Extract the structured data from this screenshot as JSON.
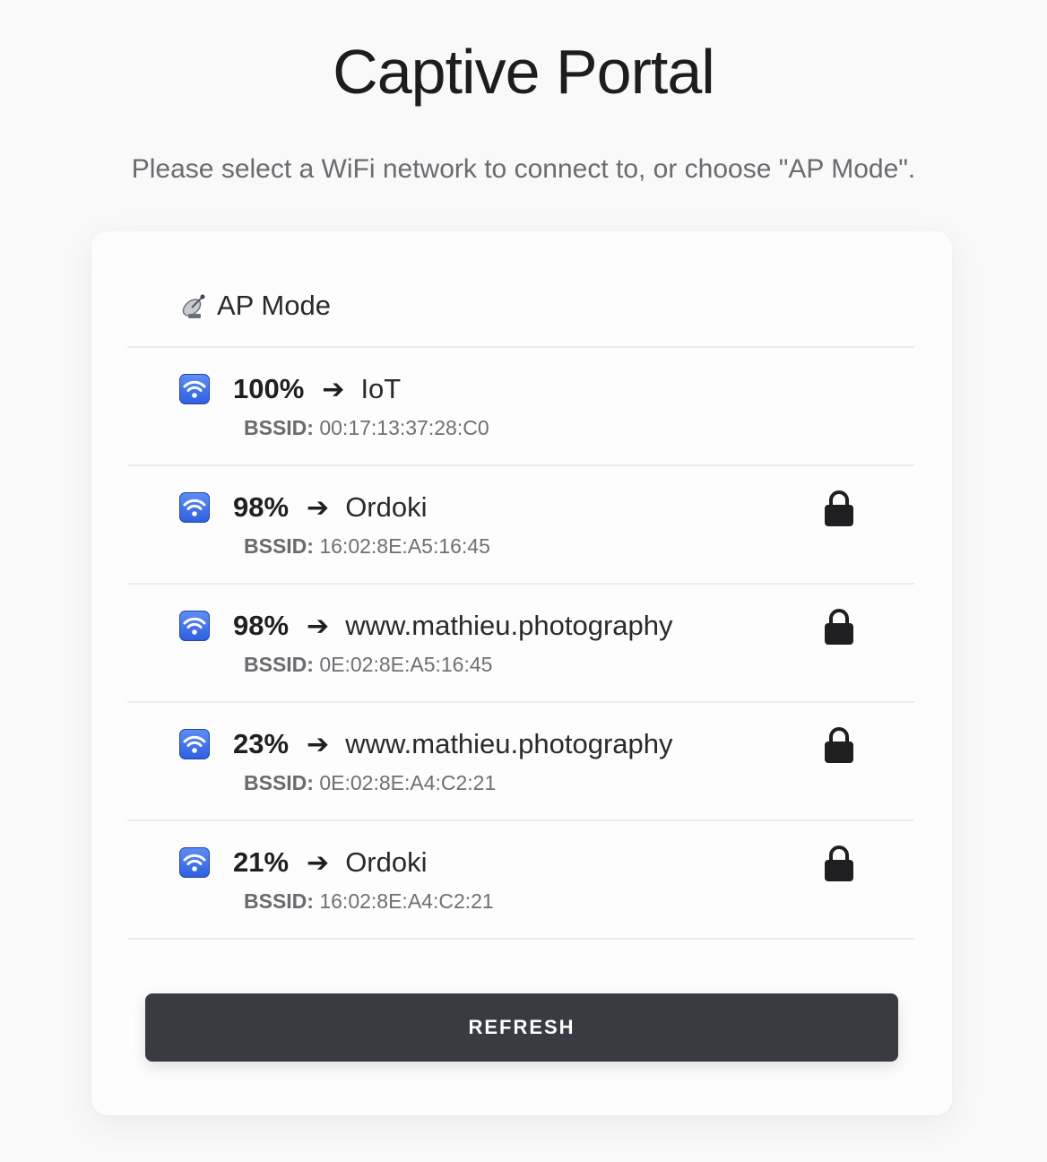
{
  "header": {
    "title": "Captive Portal",
    "subtitle": "Please select a WiFi network to connect to, or choose \"AP Mode\"."
  },
  "ap_mode": {
    "label": "AP Mode",
    "icon": "satellite-dish-icon"
  },
  "networks": [
    {
      "signal": "100%",
      "arrow": "➔",
      "ssid": "IoT",
      "bssid_label": "BSSID:",
      "bssid": "00:17:13:37:28:C0",
      "locked": false
    },
    {
      "signal": "98%",
      "arrow": "➔",
      "ssid": "Ordoki",
      "bssid_label": "BSSID:",
      "bssid": "16:02:8E:A5:16:45",
      "locked": true
    },
    {
      "signal": "98%",
      "arrow": "➔",
      "ssid": "www.mathieu.photography",
      "bssid_label": "BSSID:",
      "bssid": "0E:02:8E:A5:16:45",
      "locked": true
    },
    {
      "signal": "23%",
      "arrow": "➔",
      "ssid": "www.mathieu.photography",
      "bssid_label": "BSSID:",
      "bssid": "0E:02:8E:A4:C2:21",
      "locked": true
    },
    {
      "signal": "21%",
      "arrow": "➔",
      "ssid": "Ordoki",
      "bssid_label": "BSSID:",
      "bssid": "16:02:8E:A4:C2:21",
      "locked": true
    }
  ],
  "actions": {
    "refresh_label": "REFRESH"
  },
  "colors": {
    "button_bg": "#393b42",
    "wifi_icon": "#3b6ef0",
    "lock": "#1f1f21"
  }
}
